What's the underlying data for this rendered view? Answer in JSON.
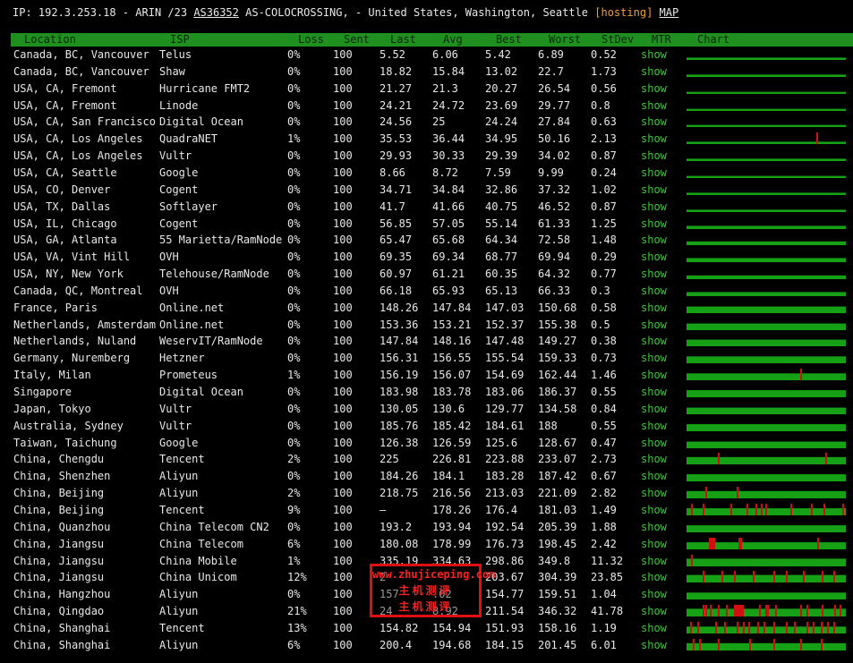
{
  "info": {
    "prefix": "IP: 192.3.253.18 - ARIN /23",
    "asn": "AS36352",
    "org": "AS-COLOCROSSING, - United States, Washington, Seattle",
    "hosting_open": "[",
    "hosting": "hosting",
    "hosting_close": "]",
    "map": "MAP"
  },
  "columns": {
    "location": "Location",
    "isp": "ISP",
    "loss": "Loss",
    "sent": "Sent",
    "last": "Last",
    "avg": "Avg",
    "best": "Best",
    "worst": "Worst",
    "stdev": "StDev",
    "mtr": "MTR",
    "chart": "Chart"
  },
  "colors": {
    "header_bg": "#1f8f1f",
    "bar": "#16a016",
    "spike": "#d01010",
    "link": "#3cc83c",
    "hosting": "#f0a030"
  },
  "rows": [
    {
      "location": "Canada, BC, Vancouver",
      "isp": "Telus",
      "loss": "0%",
      "sent": "100",
      "last": "5.52",
      "avg": "6.06",
      "best": "5.42",
      "worst": "6.89",
      "stdev": "0.52",
      "mtr": "show",
      "bar": 0.22,
      "spikes": []
    },
    {
      "location": "Canada, BC, Vancouver",
      "isp": "Shaw",
      "loss": "0%",
      "sent": "100",
      "last": "18.82",
      "avg": "15.84",
      "best": "13.02",
      "worst": "22.7",
      "stdev": "1.73",
      "mtr": "show",
      "bar": 0.22,
      "spikes": []
    },
    {
      "location": "USA, CA, Fremont",
      "isp": "Hurricane FMT2",
      "loss": "0%",
      "sent": "100",
      "last": "21.27",
      "avg": "21.3",
      "best": "20.27",
      "worst": "26.54",
      "stdev": "0.56",
      "mtr": "show",
      "bar": 0.2,
      "spikes": []
    },
    {
      "location": "USA, CA, Fremont",
      "isp": "Linode",
      "loss": "0%",
      "sent": "100",
      "last": "24.21",
      "avg": "24.72",
      "best": "23.69",
      "worst": "29.77",
      "stdev": "0.8",
      "mtr": "show",
      "bar": 0.2,
      "spikes": []
    },
    {
      "location": "USA, CA, San Francisco",
      "isp": "Digital Ocean",
      "loss": "0%",
      "sent": "100",
      "last": "24.56",
      "avg": "25",
      "best": "24.24",
      "worst": "27.84",
      "stdev": "0.63",
      "mtr": "show",
      "bar": 0.2,
      "spikes": []
    },
    {
      "location": "USA, CA, Los Angeles",
      "isp": "QuadraNET",
      "loss": "1%",
      "sent": "100",
      "last": "35.53",
      "avg": "36.44",
      "best": "34.95",
      "worst": "50.16",
      "stdev": "2.13",
      "mtr": "show",
      "bar": 0.22,
      "spikes": [
        0.825
      ]
    },
    {
      "location": "USA, CA, Los Angeles",
      "isp": "Vultr",
      "loss": "0%",
      "sent": "100",
      "last": "29.93",
      "avg": "30.33",
      "best": "29.39",
      "worst": "34.02",
      "stdev": "0.87",
      "mtr": "show",
      "bar": 0.22,
      "spikes": []
    },
    {
      "location": "USA, CA, Seattle",
      "isp": "Google",
      "loss": "0%",
      "sent": "100",
      "last": "8.66",
      "avg": "8.72",
      "best": "7.59",
      "worst": "9.99",
      "stdev": "0.24",
      "mtr": "show",
      "bar": 0.2,
      "spikes": []
    },
    {
      "location": "USA, CO, Denver",
      "isp": "Cogent",
      "loss": "0%",
      "sent": "100",
      "last": "34.71",
      "avg": "34.84",
      "best": "32.86",
      "worst": "37.32",
      "stdev": "1.02",
      "mtr": "show",
      "bar": 0.22,
      "spikes": []
    },
    {
      "location": "USA, TX, Dallas",
      "isp": "Softlayer",
      "loss": "0%",
      "sent": "100",
      "last": "41.7",
      "avg": "41.66",
      "best": "40.75",
      "worst": "46.52",
      "stdev": "0.87",
      "mtr": "show",
      "bar": 0.22,
      "spikes": []
    },
    {
      "location": "USA, IL, Chicago",
      "isp": "Cogent",
      "loss": "0%",
      "sent": "100",
      "last": "56.85",
      "avg": "57.05",
      "best": "55.14",
      "worst": "61.33",
      "stdev": "1.25",
      "mtr": "show",
      "bar": 0.3,
      "spikes": []
    },
    {
      "location": "USA, GA, Atlanta",
      "isp": "55 Marietta/RamNode",
      "loss": "0%",
      "sent": "100",
      "last": "65.47",
      "avg": "65.68",
      "best": "64.34",
      "worst": "72.58",
      "stdev": "1.48",
      "mtr": "show",
      "bar": 0.35,
      "spikes": []
    },
    {
      "location": "USA, VA, Vint Hill",
      "isp": "OVH",
      "loss": "0%",
      "sent": "100",
      "last": "69.35",
      "avg": "69.34",
      "best": "68.77",
      "worst": "69.94",
      "stdev": "0.29",
      "mtr": "show",
      "bar": 0.38,
      "spikes": []
    },
    {
      "location": "USA, NY, New York",
      "isp": "Telehouse/RamNode",
      "loss": "0%",
      "sent": "100",
      "last": "60.97",
      "avg": "61.21",
      "best": "60.35",
      "worst": "64.32",
      "stdev": "0.77",
      "mtr": "show",
      "bar": 0.35,
      "spikes": []
    },
    {
      "location": "Canada, QC, Montreal",
      "isp": "OVH",
      "loss": "0%",
      "sent": "100",
      "last": "66.18",
      "avg": "65.93",
      "best": "65.13",
      "worst": "66.33",
      "stdev": "0.3",
      "mtr": "show",
      "bar": 0.38,
      "spikes": []
    },
    {
      "location": "France, Paris",
      "isp": "Online.net",
      "loss": "0%",
      "sent": "100",
      "last": "148.26",
      "avg": "147.84",
      "best": "147.03",
      "worst": "150.68",
      "stdev": "0.58",
      "mtr": "show",
      "bar": 0.62,
      "spikes": []
    },
    {
      "location": "Netherlands, Amsterdam",
      "isp": "Online.net",
      "loss": "0%",
      "sent": "100",
      "last": "153.36",
      "avg": "153.21",
      "best": "152.37",
      "worst": "155.38",
      "stdev": "0.5",
      "mtr": "show",
      "bar": 0.62,
      "spikes": []
    },
    {
      "location": "Netherlands, Nuland",
      "isp": "WeservIT/RamNode",
      "loss": "0%",
      "sent": "100",
      "last": "147.84",
      "avg": "148.16",
      "best": "147.48",
      "worst": "149.27",
      "stdev": "0.38",
      "mtr": "show",
      "bar": 0.62,
      "spikes": []
    },
    {
      "location": "Germany, Nuremberg",
      "isp": "Hetzner",
      "loss": "0%",
      "sent": "100",
      "last": "156.31",
      "avg": "156.55",
      "best": "155.54",
      "worst": "159.33",
      "stdev": "0.73",
      "mtr": "show",
      "bar": 0.64,
      "spikes": []
    },
    {
      "location": "Italy, Milan",
      "isp": "Prometeus",
      "loss": "1%",
      "sent": "100",
      "last": "156.19",
      "avg": "156.07",
      "best": "154.69",
      "worst": "162.44",
      "stdev": "1.46",
      "mtr": "show",
      "bar": 0.64,
      "spikes": [
        0.72
      ]
    },
    {
      "location": "Singapore",
      "isp": "Digital Ocean",
      "loss": "0%",
      "sent": "100",
      "last": "183.98",
      "avg": "183.78",
      "best": "183.06",
      "worst": "186.37",
      "stdev": "0.55",
      "mtr": "show",
      "bar": 0.66,
      "spikes": []
    },
    {
      "location": "Japan, Tokyo",
      "isp": "Vultr",
      "loss": "0%",
      "sent": "100",
      "last": "130.05",
      "avg": "130.6",
      "best": "129.77",
      "worst": "134.58",
      "stdev": "0.84",
      "mtr": "show",
      "bar": 0.62,
      "spikes": []
    },
    {
      "location": "Australia, Sydney",
      "isp": "Vultr",
      "loss": "0%",
      "sent": "100",
      "last": "185.76",
      "avg": "185.42",
      "best": "184.61",
      "worst": "188",
      "stdev": "0.55",
      "mtr": "show",
      "bar": 0.66,
      "spikes": []
    },
    {
      "location": "Taiwan, Taichung",
      "isp": "Google",
      "loss": "0%",
      "sent": "100",
      "last": "126.38",
      "avg": "126.59",
      "best": "125.6",
      "worst": "128.67",
      "stdev": "0.47",
      "mtr": "show",
      "bar": 0.62,
      "spikes": []
    },
    {
      "location": "China, Chengdu",
      "isp": "Tencent",
      "loss": "2%",
      "sent": "100",
      "last": "225",
      "avg": "226.81",
      "best": "223.88",
      "worst": "233.07",
      "stdev": "2.73",
      "mtr": "show",
      "bar": 0.68,
      "spikes": [
        0.2,
        0.88
      ]
    },
    {
      "location": "China, Shenzhen",
      "isp": "Aliyun",
      "loss": "0%",
      "sent": "100",
      "last": "184.26",
      "avg": "184.1",
      "best": "183.28",
      "worst": "187.42",
      "stdev": "0.67",
      "mtr": "show",
      "bar": 0.66,
      "spikes": []
    },
    {
      "location": "China, Beijing",
      "isp": "Aliyun",
      "loss": "2%",
      "sent": "100",
      "last": "218.75",
      "avg": "216.56",
      "best": "213.03",
      "worst": "221.09",
      "stdev": "2.82",
      "mtr": "show",
      "bar": 0.68,
      "spikes": [
        0.12,
        0.32
      ]
    },
    {
      "location": "China, Beijing",
      "isp": "Tencent",
      "loss": "9%",
      "sent": "100",
      "last": "–",
      "avg": "178.26",
      "best": "176.4",
      "worst": "181.03",
      "stdev": "1.49",
      "mtr": "show",
      "bar": 0.66,
      "spikes": [
        0.03,
        0.1,
        0.28,
        0.38,
        0.44,
        0.47,
        0.5,
        0.66,
        0.79,
        0.87,
        0.99
      ]
    },
    {
      "location": "China, Quanzhou",
      "isp": "China Telecom CN2",
      "loss": "0%",
      "sent": "100",
      "last": "193.2",
      "avg": "193.94",
      "best": "192.54",
      "worst": "205.39",
      "stdev": "1.88",
      "mtr": "show",
      "bar": 0.66,
      "spikes": []
    },
    {
      "location": "China, Jiangsu",
      "isp": "China Telecom",
      "loss": "6%",
      "sent": "100",
      "last": "180.08",
      "avg": "178.99",
      "best": "176.73",
      "worst": "198.45",
      "stdev": "2.42",
      "mtr": "show",
      "bar": 0.66,
      "spikes": [
        0.14,
        0.15,
        0.16,
        0.17,
        0.33,
        0.34,
        0.83
      ]
    },
    {
      "location": "China, Jiangsu",
      "isp": "China Mobile",
      "loss": "1%",
      "sent": "100",
      "last": "335.19",
      "avg": "334.63",
      "best": "298.86",
      "worst": "349.8",
      "stdev": "11.32",
      "mtr": "show",
      "bar": 0.72,
      "spikes": [
        0.03
      ]
    },
    {
      "location": "China, Jiangsu",
      "isp": "China Unicom",
      "loss": "12%",
      "sent": "100",
      "last": "2",
      "avg": "",
      "best": "203.67",
      "worst": "304.39",
      "stdev": "23.85",
      "mtr": "show",
      "bar": 0.7,
      "spikes": [
        0.1,
        0.22,
        0.3,
        0.42,
        0.55,
        0.63,
        0.74,
        0.86,
        0.93
      ]
    },
    {
      "location": "China, Hangzhou",
      "isp": "Aliyun",
      "loss": "0%",
      "sent": "100",
      "last": "157",
      "avg": ".02",
      "best": "154.77",
      "worst": "159.51",
      "stdev": "1.04",
      "mtr": "show",
      "bar": 0.64,
      "spikes": []
    },
    {
      "location": "China, Qingdao",
      "isp": "Aliyun",
      "loss": "21%",
      "sent": "100",
      "last": "24",
      "avg": "8.92",
      "best": "211.54",
      "worst": "346.32",
      "stdev": "41.78",
      "mtr": "show",
      "bar": 0.72,
      "spikes": [
        0.1,
        0.12,
        0.15,
        0.2,
        0.25,
        0.3,
        0.31,
        0.32,
        0.33,
        0.34,
        0.35,
        0.46,
        0.5,
        0.51,
        0.56,
        0.72,
        0.76,
        0.86,
        0.94,
        0.97
      ]
    },
    {
      "location": "China, Shanghai",
      "isp": "Tencent",
      "loss": "13%",
      "sent": "100",
      "last": "154.82",
      "avg": "154.94",
      "best": "151.93",
      "worst": "158.16",
      "stdev": "1.19",
      "mtr": "show",
      "bar": 0.64,
      "spikes": [
        0.02,
        0.07,
        0.18,
        0.24,
        0.32,
        0.36,
        0.39,
        0.45,
        0.49,
        0.55,
        0.63,
        0.68,
        0.76,
        0.8,
        0.85,
        0.89,
        0.93
      ]
    },
    {
      "location": "China, Shanghai",
      "isp": "Aliyun",
      "loss": "6%",
      "sent": "100",
      "last": "200.4",
      "avg": "194.68",
      "best": "184.15",
      "worst": "201.45",
      "stdev": "6.01",
      "mtr": "show",
      "bar": 0.68,
      "spikes": [
        0.04,
        0.08,
        0.2,
        0.4,
        0.55,
        0.72,
        0.85
      ]
    }
  ],
  "watermark": {
    "line1": "www.zhujiceping.com",
    "line2": "主机测评",
    "line3": "主机测评"
  }
}
